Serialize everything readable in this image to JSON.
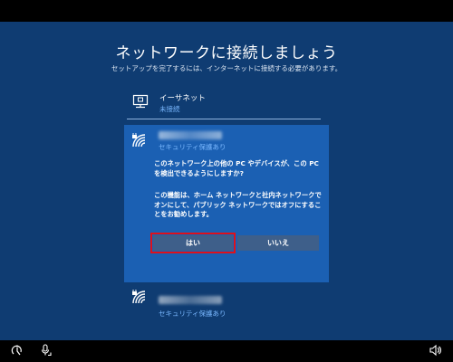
{
  "page": {
    "title": "ネットワークに接続しましょう",
    "subtitle": "セットアップを完了するには、インターネットに接続する必要があります。"
  },
  "networks": [
    {
      "name": "イーサネット",
      "status": "未接続",
      "icon": "ethernet-icon"
    },
    {
      "name": "",
      "status": "セキュリティ保護あり",
      "icon": "wifi-secured-icon"
    },
    {
      "name": "",
      "status": "セキュリティ保護あり",
      "icon": "wifi-secured-icon"
    }
  ],
  "dialog": {
    "question": "このネットワーク上の他の PC やデバイスが、この PC を検出できるようにしますか?",
    "explanation": "この機能は、ホーム ネットワークと社内ネットワークでオンにして、パブリック ネットワークではオフにすることをお勧めします。",
    "yes_label": "はい",
    "no_label": "いいえ"
  },
  "taskbar": {
    "left_icons": [
      "ease-of-access-icon",
      "microphone-icon"
    ],
    "right_icons": [
      "volume-icon"
    ]
  },
  "colors": {
    "background": "#0f3c72",
    "panel": "#1b60b3",
    "link": "#7ab8ff",
    "button": "#3e5f8a",
    "highlight": "#e0101a"
  }
}
